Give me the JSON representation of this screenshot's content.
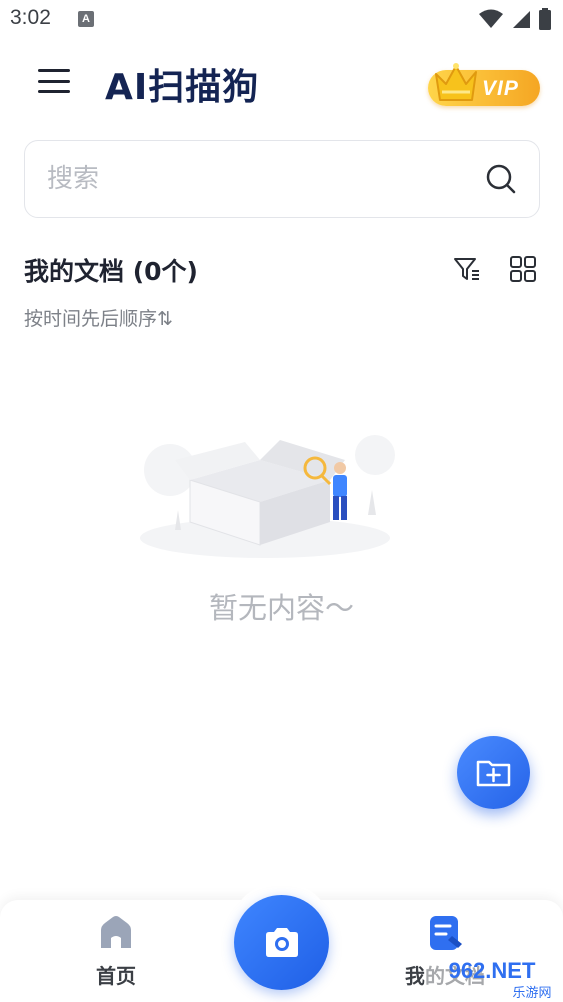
{
  "status_bar": {
    "time": "3:02",
    "notif_letter": "A"
  },
  "header": {
    "title": "AI扫描狗",
    "vip_label": "VIP"
  },
  "search": {
    "placeholder": "搜索"
  },
  "documents": {
    "title": "我的文档 (0个)",
    "sort_label": "按时间先后顺序⇅"
  },
  "empty_state": {
    "message": "暂无内容～"
  },
  "bottom_nav": {
    "home_label": "首页",
    "docs_label": "我的文档"
  },
  "watermark": {
    "text": "962.NET",
    "subtext": "乐游网"
  },
  "colors": {
    "accent": "#2f6ff0",
    "title": "#142453",
    "vip_gold": "#f5a623"
  },
  "icons": [
    "menu-icon",
    "crown-icon",
    "search-icon",
    "filter-icon",
    "grid-view-icon",
    "add-folder-icon",
    "home-icon",
    "camera-icon",
    "document-icon",
    "wifi-icon",
    "signal-icon",
    "battery-icon"
  ]
}
